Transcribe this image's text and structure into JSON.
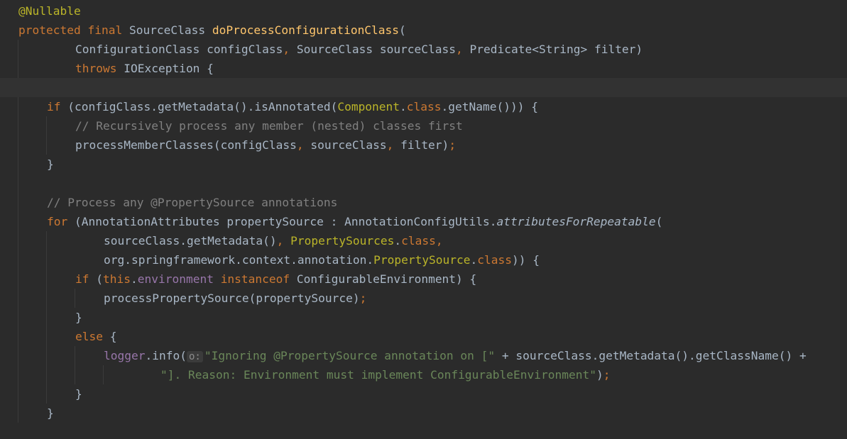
{
  "editor": {
    "colors": {
      "background": "#2b2b2b",
      "current_line": "#323232",
      "keyword": "#cc7832",
      "annotation": "#bbb529",
      "method_declaration": "#ffc66d",
      "comment": "#808080",
      "string": "#6a8759",
      "field": "#9876aa",
      "default_text": "#a9b7c6"
    },
    "current_line_index": 4,
    "lines": [
      {
        "indent": 1,
        "tokens": [
          [
            "@Nullable",
            "annotation"
          ]
        ]
      },
      {
        "indent": 1,
        "tokens": [
          [
            "protected",
            "keyword"
          ],
          [
            " ",
            "default"
          ],
          [
            "final",
            "keyword"
          ],
          [
            " SourceClass ",
            "default"
          ],
          [
            "doProcessConfigurationClass",
            "method"
          ],
          [
            "(",
            "default"
          ]
        ]
      },
      {
        "indent": 5,
        "tokens": [
          [
            "ConfigurationClass configClass",
            "default"
          ],
          [
            ", ",
            "punct"
          ],
          [
            "SourceClass sourceClass",
            "default"
          ],
          [
            ", ",
            "punct"
          ],
          [
            "Predicate<String> filter)",
            "default"
          ]
        ]
      },
      {
        "indent": 5,
        "tokens": [
          [
            "throws",
            "keyword"
          ],
          [
            " IOException {",
            "default"
          ]
        ]
      },
      {
        "indent": 0,
        "tokens": []
      },
      {
        "indent": 3,
        "tokens": [
          [
            "if",
            "keyword"
          ],
          [
            " (configClass.getMetadata().isAnnotated(",
            "default"
          ],
          [
            "Component",
            "annotype"
          ],
          [
            ".",
            "default"
          ],
          [
            "class",
            "keyword"
          ],
          [
            ".getName())) {",
            "default"
          ]
        ]
      },
      {
        "indent": 5,
        "tokens": [
          [
            "// Recursively process any member (nested) classes first",
            "comment"
          ]
        ]
      },
      {
        "indent": 5,
        "tokens": [
          [
            "processMemberClasses(configClass",
            "default"
          ],
          [
            ", ",
            "punct"
          ],
          [
            "sourceClass",
            "default"
          ],
          [
            ", ",
            "punct"
          ],
          [
            "filter)",
            "default"
          ],
          [
            ";",
            "punct"
          ]
        ]
      },
      {
        "indent": 3,
        "tokens": [
          [
            "}",
            "default"
          ]
        ]
      },
      {
        "indent": 0,
        "tokens": []
      },
      {
        "indent": 3,
        "tokens": [
          [
            "// Process any @PropertySource annotations",
            "comment"
          ]
        ]
      },
      {
        "indent": 3,
        "tokens": [
          [
            "for",
            "keyword"
          ],
          [
            " (AnnotationAttributes propertySource : AnnotationConfigUtils.",
            "default"
          ],
          [
            "attributesForRepeatable",
            "static"
          ],
          [
            "(",
            "default"
          ]
        ]
      },
      {
        "indent": 7,
        "tokens": [
          [
            "sourceClass.getMetadata()",
            "default"
          ],
          [
            ", ",
            "punct"
          ],
          [
            "PropertySources",
            "annotype"
          ],
          [
            ".",
            "default"
          ],
          [
            "class",
            "keyword"
          ],
          [
            ",",
            "punct"
          ]
        ]
      },
      {
        "indent": 7,
        "tokens": [
          [
            "org.springframework.context.annotation.",
            "default"
          ],
          [
            "PropertySource",
            "annotype"
          ],
          [
            ".",
            "default"
          ],
          [
            "class",
            "keyword"
          ],
          [
            ")) {",
            "default"
          ]
        ]
      },
      {
        "indent": 5,
        "tokens": [
          [
            "if",
            "keyword"
          ],
          [
            " (",
            "default"
          ],
          [
            "this",
            "keyword"
          ],
          [
            ".",
            "default"
          ],
          [
            "environment",
            "field"
          ],
          [
            " ",
            "default"
          ],
          [
            "instanceof",
            "keyword"
          ],
          [
            " ConfigurableEnvironment) {",
            "default"
          ]
        ]
      },
      {
        "indent": 7,
        "tokens": [
          [
            "processPropertySource(propertySource)",
            "default"
          ],
          [
            ";",
            "punct"
          ]
        ]
      },
      {
        "indent": 5,
        "tokens": [
          [
            "}",
            "default"
          ]
        ]
      },
      {
        "indent": 5,
        "tokens": [
          [
            "else",
            "keyword"
          ],
          [
            " {",
            "default"
          ]
        ]
      },
      {
        "indent": 7,
        "tokens": [
          [
            "logger",
            "field"
          ],
          [
            ".info(",
            "default"
          ],
          [
            "o:",
            "hint"
          ],
          [
            "\"Ignoring @PropertySource annotation on [\"",
            "string"
          ],
          [
            " + sourceClass.getMetadata().getClassName() +",
            "default"
          ]
        ]
      },
      {
        "indent": 11,
        "tokens": [
          [
            "\"]. Reason: Environment must implement ConfigurableEnvironment\"",
            "string"
          ],
          [
            ")",
            "default"
          ],
          [
            ";",
            "punct"
          ]
        ]
      },
      {
        "indent": 5,
        "tokens": [
          [
            "}",
            "default"
          ]
        ]
      },
      {
        "indent": 3,
        "tokens": [
          [
            "}",
            "default"
          ]
        ]
      },
      {
        "indent": 0,
        "tokens": []
      }
    ]
  }
}
